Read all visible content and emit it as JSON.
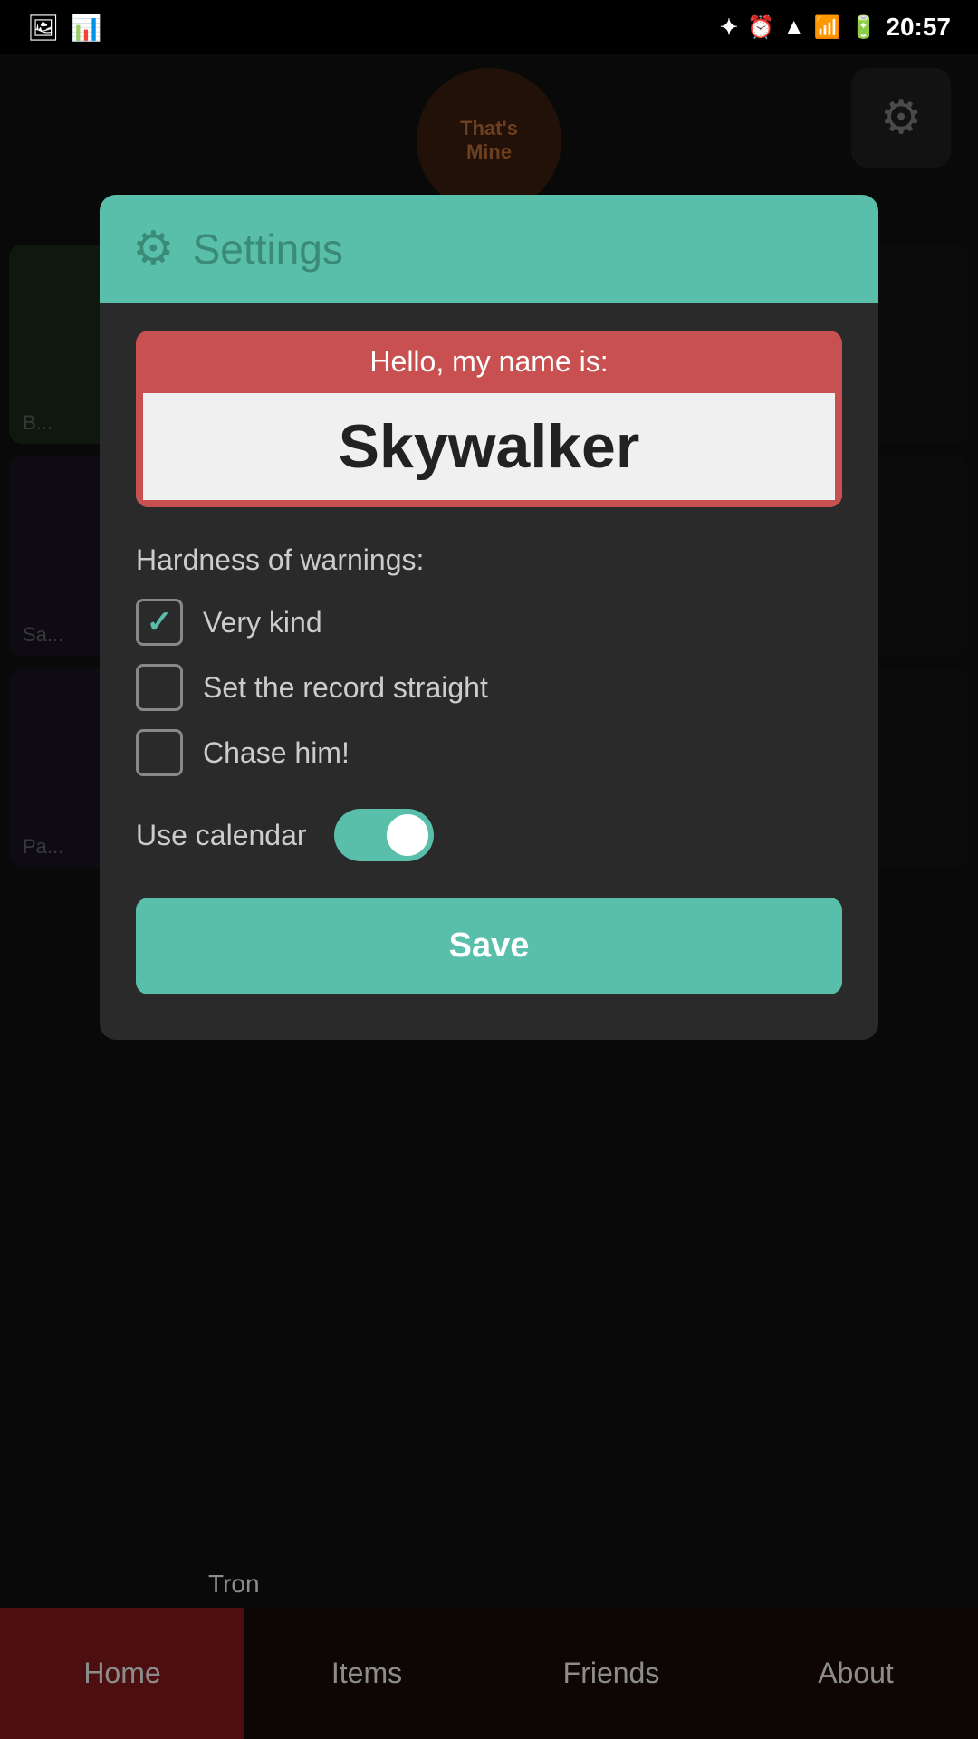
{
  "statusBar": {
    "time": "20:57",
    "icons": [
      "bluetooth",
      "alarm",
      "wifi",
      "signal",
      "battery"
    ]
  },
  "logo": {
    "line1": "That's",
    "line2": "Mine"
  },
  "settings": {
    "header": {
      "icon": "⚙",
      "title": "Settings"
    },
    "nameBadge": {
      "topText": "Hello, my name is:",
      "name": "Skywalker"
    },
    "hardnessLabel": "Hardness of warnings:",
    "checkboxOptions": [
      {
        "label": "Very kind",
        "checked": true
      },
      {
        "label": "Set the record straight",
        "checked": false
      },
      {
        "label": "Chase him!",
        "checked": false
      }
    ],
    "calendar": {
      "label": "Use calendar",
      "enabled": true
    },
    "saveButton": "Save"
  },
  "bottomNav": {
    "items": [
      {
        "label": "Home",
        "active": true
      },
      {
        "label": "Items",
        "active": false
      },
      {
        "label": "Friends",
        "active": false
      },
      {
        "label": "About",
        "active": false
      }
    ]
  },
  "backgroundLabels": {
    "tron": "Tron"
  }
}
